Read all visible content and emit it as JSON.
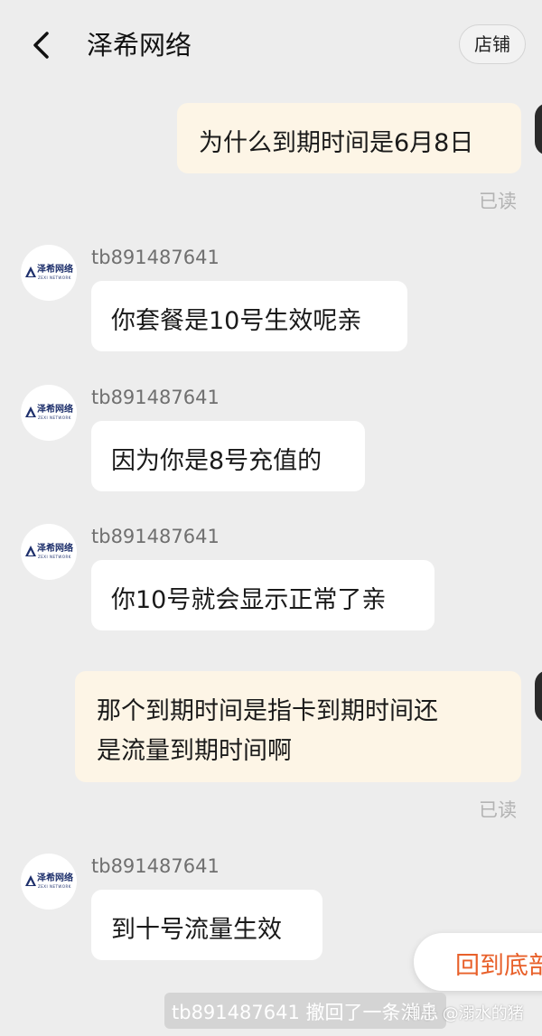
{
  "header": {
    "title": "泽希网络",
    "store_button": "店铺"
  },
  "avatar_logo": {
    "name": "泽希网络",
    "subtitle": "ZEXI NETWORK"
  },
  "messages": [
    {
      "direction": "outgoing",
      "text": "为什么到期时间是6月8日",
      "status": "已读"
    },
    {
      "direction": "incoming",
      "sender": "tb891487641",
      "text": "你套餐是10号生效呢亲"
    },
    {
      "direction": "incoming",
      "sender": "tb891487641",
      "text": "因为你是8号充值的"
    },
    {
      "direction": "incoming",
      "sender": "tb891487641",
      "text": "你10号就会显示正常了亲"
    },
    {
      "direction": "outgoing",
      "lines": [
        "那个到期时间是指卡到期时间还",
        "是流量到期时间啊"
      ],
      "status": "已读"
    },
    {
      "direction": "incoming",
      "sender": "tb891487641",
      "text": "到十号流量生效"
    }
  ],
  "back_to_bottom": "回到底部",
  "recall_notice": "tb891487641 撤回了一条消息",
  "watermark": "知乎 @溺水的猪",
  "colors": {
    "background": "#ededed",
    "outgoing_bubble": "#fdf5e6",
    "incoming_bubble": "#ffffff",
    "accent": "#e8602a",
    "logo": "#1d2f6b"
  }
}
